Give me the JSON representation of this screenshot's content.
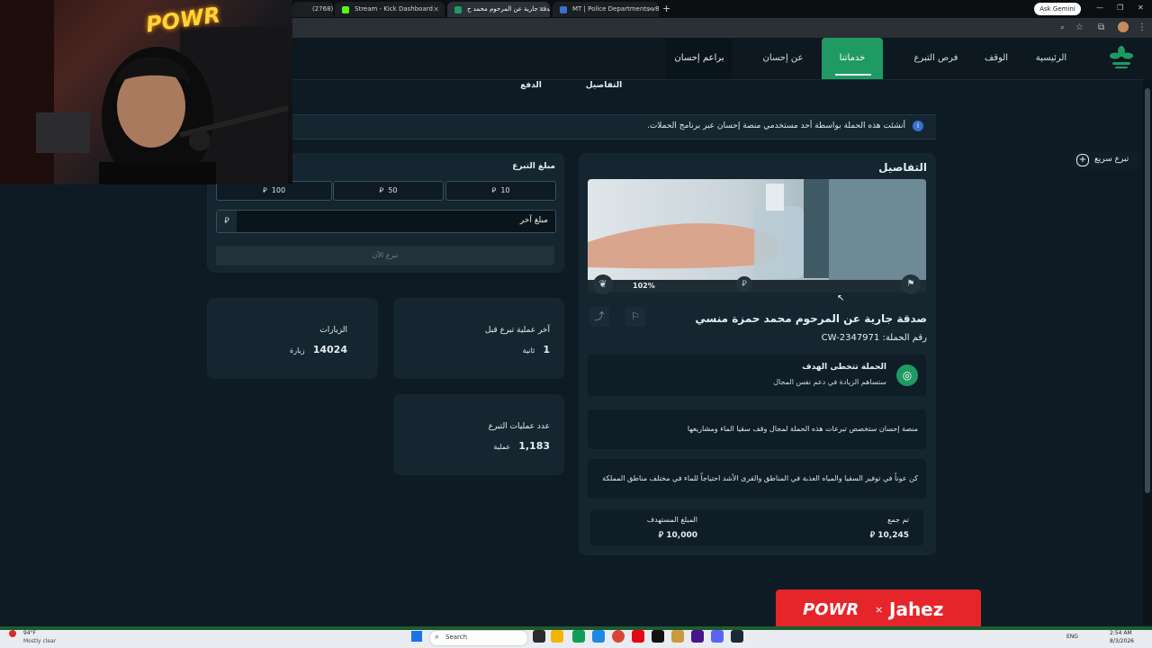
{
  "browser": {
    "tabs": [
      {
        "label": "(2768) شيلة"
      },
      {
        "label": "Stream - Kick Dashboard"
      },
      {
        "label": "صدقة جارية عن المرحوم محمد ح..."
      },
      {
        "label": "MT | Police Departments v8.0"
      }
    ],
    "new_tab": "+",
    "ask_gemini": "Ask Gemini"
  },
  "nav": {
    "home": "الرئيسية",
    "waqf": "الوقف",
    "opportunities": "فرص التبرع",
    "services": "خدماتنا",
    "about": "عن إحسان",
    "programs": "براعم إحسان"
  },
  "steps": {
    "details": "التفاصيل",
    "payment": "الدفع"
  },
  "notice": "أنشئت هذه الحملة بواسطة أحد مستخدمي منصة إحسان عبر برنامج الحملات.",
  "quick_donate": "تبرع سريع",
  "details_card": {
    "title": "التفاصيل",
    "progress_label": "102%",
    "progress_fraction": 1.0,
    "campaign_title": "صدقة جارية عن المرحوم محمد حمزة منسي",
    "campaign_number_label": "رقم الحملة:",
    "campaign_number": "CW-2347971",
    "goal_title": "الحملة تتخطى الهدف",
    "goal_sub": "ستساهم الزيادة في دعم نفس المجال",
    "desc1": "منصة إحسان ستخصص تبرعات هذه الحملة لمجال وقف سقيا الماء ومشاريعها",
    "desc2": "كن عوناً في توفير السقيا والمياه العذبة في المناطق والقرى الأشد احتياجاً للماء في مختلف مناطق المملكة",
    "collected_label": "تم جمع",
    "collected_value": "10,245",
    "target_label": "المبلغ المستهدف",
    "target_value": "10,000"
  },
  "donate_card": {
    "title": "مبلغ التبرع",
    "amounts": [
      "10",
      "50",
      "100"
    ],
    "other_placeholder": "مبلغ آخر",
    "donate_now": "تبرع الآن"
  },
  "stats": {
    "last_donation_label": "آخر عملية تبرع قبل",
    "last_donation_value": "1",
    "last_donation_unit": "ثانية",
    "visits_label": "الزيارات",
    "visits_value": "14024",
    "visits_unit": "زيارة",
    "ops_label": "عدد عمليات التبرع",
    "ops_value": "1,183",
    "ops_unit": "عملية"
  },
  "overlay": {
    "brand": "POWR",
    "x": "×",
    "partner": "Jahez"
  },
  "taskbar": {
    "temp": "94°F",
    "weather": "Mostly clear",
    "search": "Search",
    "lang": "ENG",
    "time": "2:54 AM",
    "date": "8/3/2026"
  },
  "colors": {
    "accent": "#1f9a63",
    "bg": "#0e1b24",
    "card": "#152631"
  }
}
